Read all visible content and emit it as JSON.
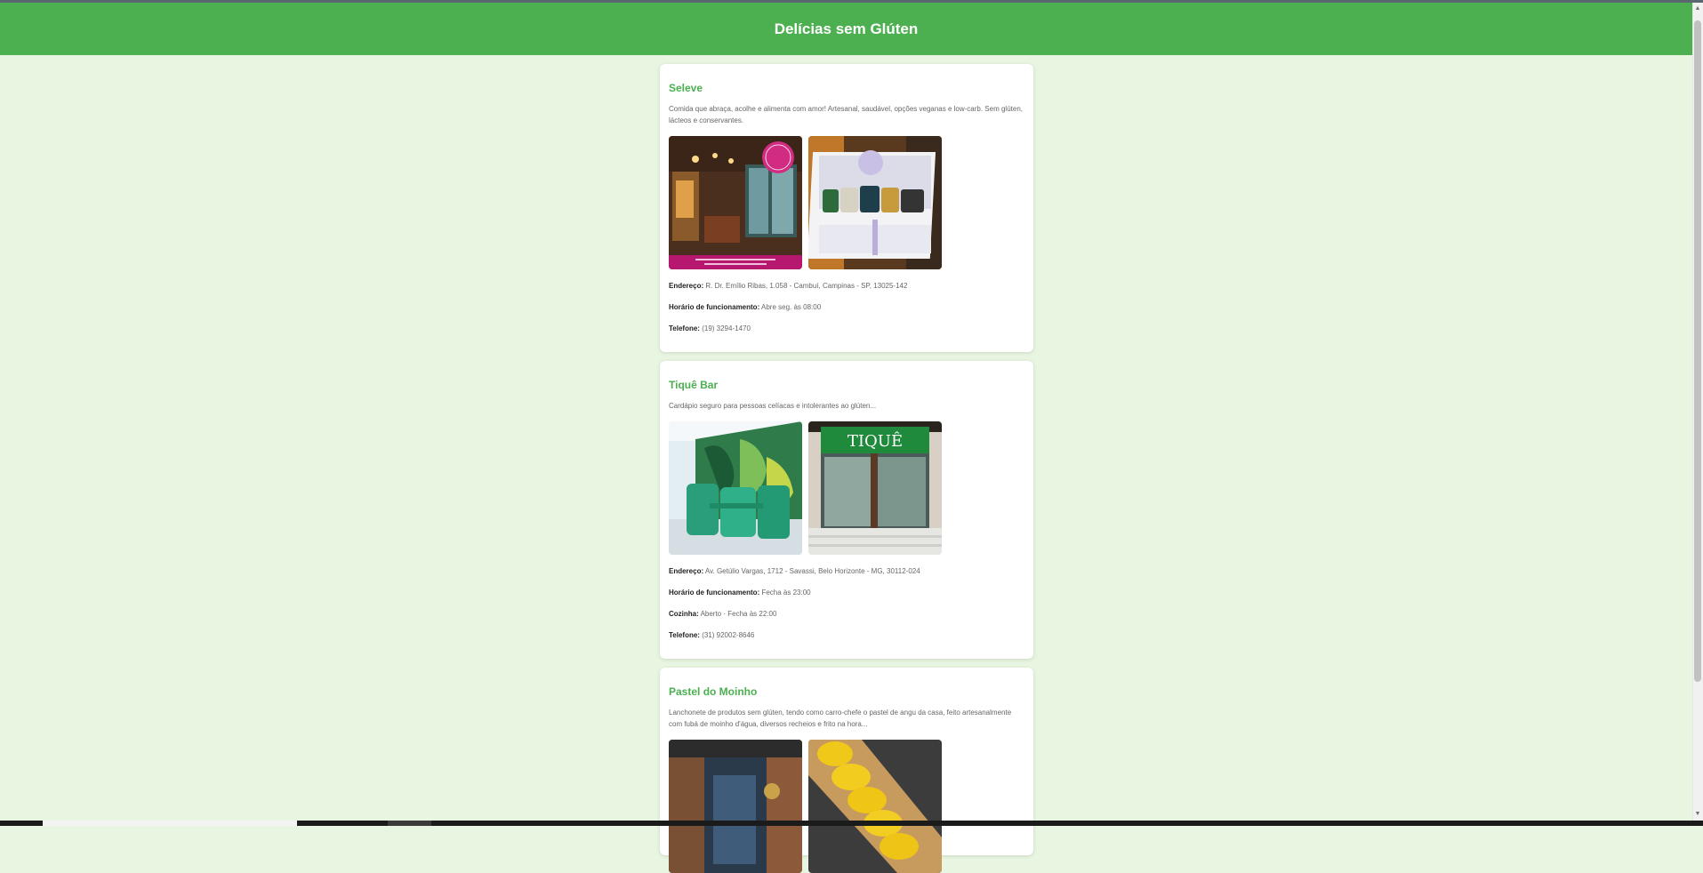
{
  "header": {
    "title": "Delícias sem Glúten"
  },
  "colors": {
    "accent": "#4caf50",
    "background": "#e8f5e0"
  },
  "restaurants": [
    {
      "name": "Seleve",
      "description": "Comida que abraça, acolhe e alimenta com amor! Artesanal, saudável, opções veganas e low-carb. Sem glúten, lácteos e conservantes.",
      "images": [
        "restaurant-interior",
        "gift-box-products"
      ],
      "fields": [
        {
          "label": "Endereço:",
          "value": "R. Dr. Emílio Ribas, 1.058 - Cambuí, Campinas - SP, 13025-142"
        },
        {
          "label": "Horário de funcionamento:",
          "value": "Abre seg. às 08:00"
        },
        {
          "label": "Telefone:",
          "value": "(19) 3294-1470"
        }
      ]
    },
    {
      "name": "Tiquê Bar",
      "description": "Cardápio seguro para pessoas celíacas e intolerantes ao glúten...",
      "images": [
        "green-chairs-mural",
        "storefront-sign"
      ],
      "fields": [
        {
          "label": "Endereço:",
          "value": "Av. Getúlio Vargas, 1712 - Savassi, Belo Horizonte - MG, 30112-024"
        },
        {
          "label": "Horário de funcionamento:",
          "value": "Fecha às 23:00"
        },
        {
          "label": "Cozinha:",
          "value": "Aberto · Fecha às 22:00"
        },
        {
          "label": "Telefone:",
          "value": "(31) 92002-8646"
        }
      ]
    },
    {
      "name": "Pastel do Moinho",
      "description": "Lanchonete de produtos sem glúten, tendo como carro-chefe o pastel de angu da casa, feito artesanalmente com fubá de moinho d'água, diversos recheios e frito na hora...",
      "images": [
        "shop-entrance",
        "fried-pastels"
      ],
      "fields": []
    }
  ]
}
